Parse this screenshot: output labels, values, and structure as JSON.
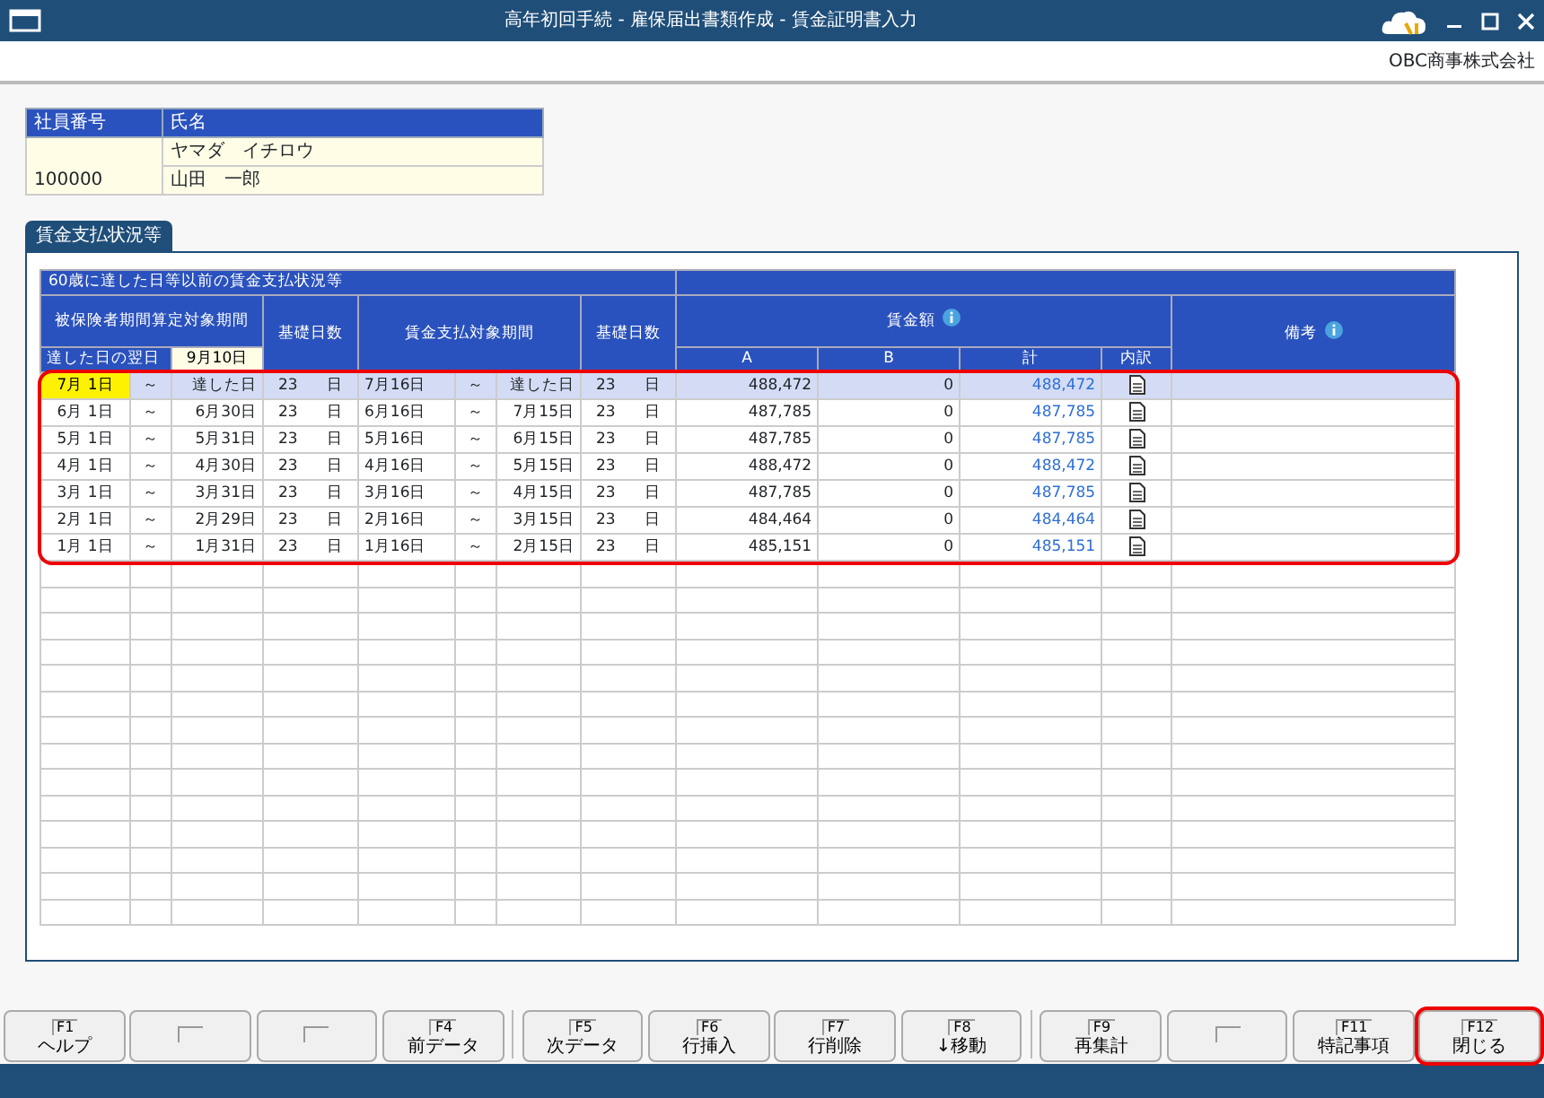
{
  "window": {
    "title": "高年初回手続 - 雇保届出書類作成 - 賃金証明書入力"
  },
  "company": "OBC商事株式会社",
  "employee": {
    "number_label": "社員番号",
    "name_label": "氏名",
    "number": "100000",
    "name_kana": "ヤマダ　イチロウ",
    "name": "山田　一郎"
  },
  "tab": {
    "label": "賃金支払状況等",
    "selected": true
  },
  "grid": {
    "title": "60歳に達した日等以前の賃金支払状況等",
    "period_header": "被保険者期間算定対象期間",
    "days_header": "基礎日数",
    "wage_period_header": "賃金支払対象期間",
    "wage_days_header": "基礎日数",
    "wage_header": "賃金額",
    "remarks_header": "備考",
    "next_day_label": "達した日の翌日",
    "next_day": "9月10日",
    "col_a": "A",
    "col_b": "B",
    "col_total": "計",
    "col_detail": "内訳",
    "highlighted": true,
    "rows": [
      {
        "from": "7月 1日",
        "tilde": "～",
        "to": "達した日",
        "days": "23",
        "days_unit": "日",
        "wage_from": "7月16日",
        "wage_tilde": "～",
        "wage_to": "達した日",
        "wage_days": "23",
        "wage_days_unit": "日",
        "a": "488,472",
        "b": "0",
        "total": "488,472",
        "selected": true,
        "focused": true
      },
      {
        "from": "6月 1日",
        "tilde": "～",
        "to": "6月30日",
        "days": "23",
        "days_unit": "日",
        "wage_from": "6月16日",
        "wage_tilde": "～",
        "wage_to": "7月15日",
        "wage_days": "23",
        "wage_days_unit": "日",
        "a": "487,785",
        "b": "0",
        "total": "487,785",
        "selected": false,
        "focused": false
      },
      {
        "from": "5月 1日",
        "tilde": "～",
        "to": "5月31日",
        "days": "23",
        "days_unit": "日",
        "wage_from": "5月16日",
        "wage_tilde": "～",
        "wage_to": "6月15日",
        "wage_days": "23",
        "wage_days_unit": "日",
        "a": "487,785",
        "b": "0",
        "total": "487,785",
        "selected": false,
        "focused": false
      },
      {
        "from": "4月 1日",
        "tilde": "～",
        "to": "4月30日",
        "days": "23",
        "days_unit": "日",
        "wage_from": "4月16日",
        "wage_tilde": "～",
        "wage_to": "5月15日",
        "wage_days": "23",
        "wage_days_unit": "日",
        "a": "488,472",
        "b": "0",
        "total": "488,472",
        "selected": false,
        "focused": false
      },
      {
        "from": "3月 1日",
        "tilde": "～",
        "to": "3月31日",
        "days": "23",
        "days_unit": "日",
        "wage_from": "3月16日",
        "wage_tilde": "～",
        "wage_to": "4月15日",
        "wage_days": "23",
        "wage_days_unit": "日",
        "a": "487,785",
        "b": "0",
        "total": "487,785",
        "selected": false,
        "focused": false
      },
      {
        "from": "2月 1日",
        "tilde": "～",
        "to": "2月29日",
        "days": "23",
        "days_unit": "日",
        "wage_from": "2月16日",
        "wage_tilde": "～",
        "wage_to": "3月15日",
        "wage_days": "23",
        "wage_days_unit": "日",
        "a": "484,464",
        "b": "0",
        "total": "484,464",
        "selected": false,
        "focused": false
      },
      {
        "from": "1月 1日",
        "tilde": "～",
        "to": "1月31日",
        "days": "23",
        "days_unit": "日",
        "wage_from": "1月16日",
        "wage_tilde": "～",
        "wage_to": "2月15日",
        "wage_days": "23",
        "wage_days_unit": "日",
        "a": "485,151",
        "b": "0",
        "total": "485,151",
        "selected": false,
        "focused": false
      }
    ]
  },
  "function_keys": [
    {
      "key": "F1",
      "label": "ヘルプ",
      "highlighted": false,
      "separator_before": false
    },
    {
      "highlighted": false,
      "separator_before": false
    },
    {
      "highlighted": false,
      "separator_before": false
    },
    {
      "key": "F4",
      "label": "前データ",
      "highlighted": false,
      "separator_before": false
    },
    {
      "key": "F5",
      "label": "次データ",
      "highlighted": false,
      "separator_before": true
    },
    {
      "key": "F6",
      "label": "行挿入",
      "highlighted": false,
      "separator_before": false
    },
    {
      "key": "F7",
      "label": "行削除",
      "highlighted": false,
      "separator_before": false
    },
    {
      "key": "F8",
      "label": "↓移動",
      "highlighted": false,
      "separator_before": false
    },
    {
      "key": "F9",
      "label": "再集計",
      "highlighted": false,
      "separator_before": true
    },
    {
      "highlighted": false,
      "separator_before": false
    },
    {
      "key": "F11",
      "label": "特記事項",
      "highlighted": false,
      "separator_before": false
    },
    {
      "key": "F12",
      "label": "閉じる",
      "highlighted": true,
      "separator_before": false
    }
  ]
}
